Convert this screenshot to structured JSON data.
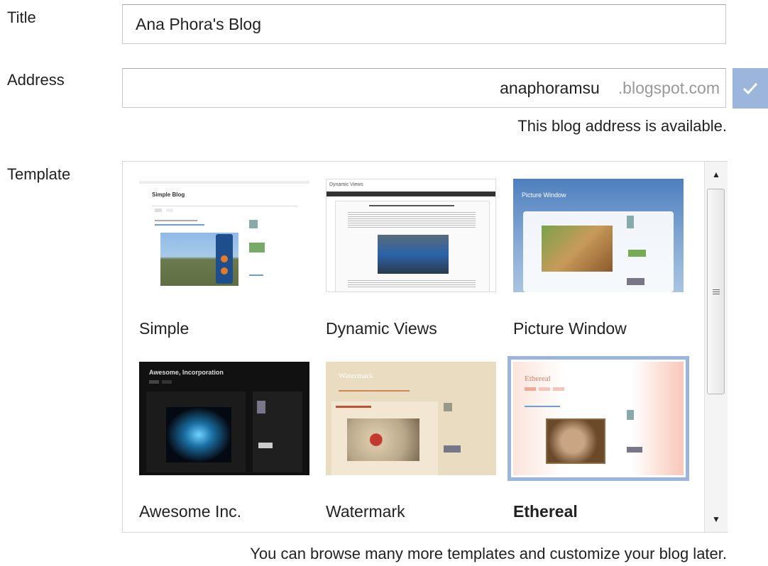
{
  "form": {
    "title_label": "Title",
    "title_value": "Ana Phora's Blog",
    "address_label": "Address",
    "address_value": "anaphoramsu",
    "address_suffix": ".blogspot.com",
    "address_status": "This blog address is available.",
    "template_label": "Template",
    "footer_note": "You can browse many more templates and customize your blog later."
  },
  "templates": [
    {
      "name": "Simple",
      "selected": false,
      "thumb_title": "Simple Blog"
    },
    {
      "name": "Dynamic Views",
      "selected": false,
      "thumb_title": "Dynamic Views"
    },
    {
      "name": "Picture Window",
      "selected": false,
      "thumb_title": "Picture Window"
    },
    {
      "name": "Awesome Inc.",
      "selected": false,
      "thumb_title": "Awesome, Incorporation"
    },
    {
      "name": "Watermark",
      "selected": false,
      "thumb_title": "Watermark"
    },
    {
      "name": "Ethereal",
      "selected": true,
      "thumb_title": "Ethereal"
    }
  ],
  "colors": {
    "accent": "#9bb5dd",
    "text": "#222222",
    "muted": "#999999"
  }
}
